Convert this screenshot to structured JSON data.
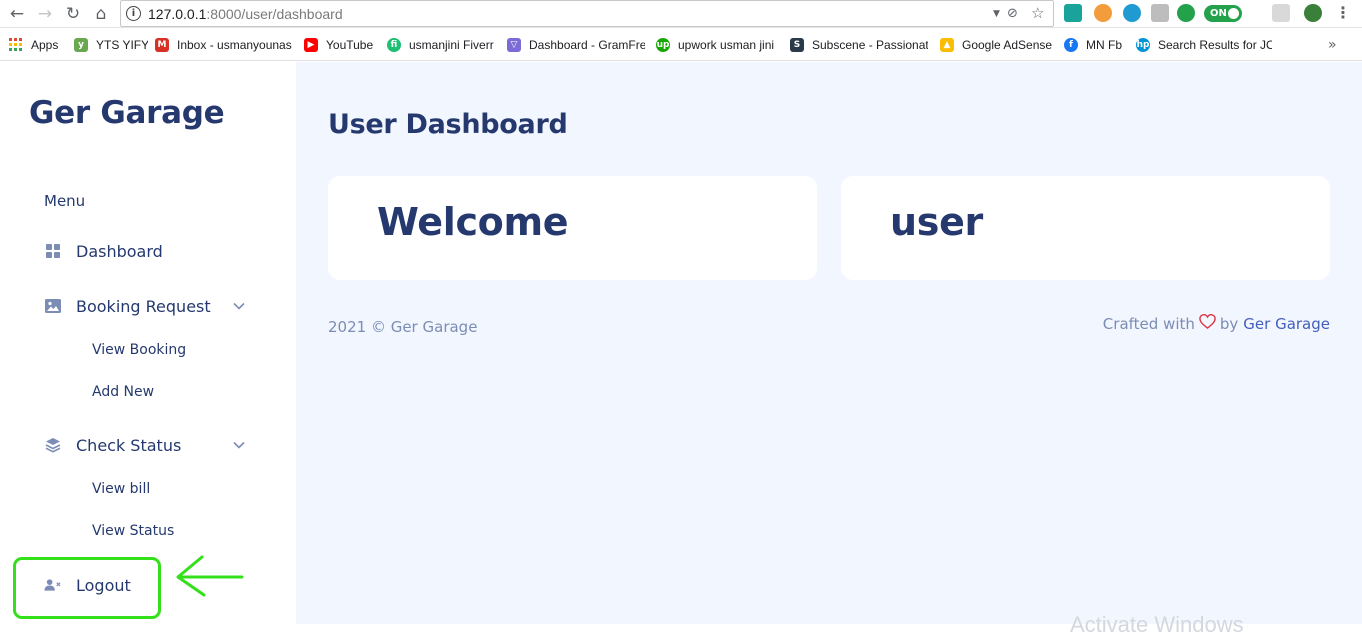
{
  "browser": {
    "url_host": "127.0.0.1",
    "url_rest": ":8000/user/dashboard",
    "toggle_label": "ON",
    "bookmarks": [
      {
        "label": "Apps",
        "icon": "apps-grid-icon",
        "color": "#e04a3b"
      },
      {
        "label": "YTS YIFY",
        "icon": "yts-icon",
        "color": "#6aa84f"
      },
      {
        "label": "Inbox - usmanyounas",
        "icon": "gmail-icon",
        "color": "#d93025"
      },
      {
        "label": "YouTube",
        "icon": "youtube-icon",
        "color": "#ff0000"
      },
      {
        "label": "usmanjini Fiverr",
        "icon": "fiverr-icon",
        "color": "#1dbf73"
      },
      {
        "label": "Dashboard - GramFre",
        "icon": "gramfree-icon",
        "color": "#7b6bd6"
      },
      {
        "label": "upwork usman jini",
        "icon": "upwork-icon",
        "color": "#14a800"
      },
      {
        "label": "Subscene - Passionat",
        "icon": "subscene-icon",
        "color": "#2b3a4a"
      },
      {
        "label": "Google AdSense",
        "icon": "adsense-icon",
        "color": "#fbbc04"
      },
      {
        "label": "MN Fb",
        "icon": "facebook-icon",
        "color": "#1877f2"
      },
      {
        "label": "Search Results for JOB",
        "icon": "hp-icon",
        "color": "#0096d6"
      }
    ]
  },
  "sidebar": {
    "brand": "Ger Garage",
    "menu_title": "Menu",
    "items": [
      {
        "label": "Dashboard",
        "icon": "grid-icon"
      },
      {
        "label": "Booking Request",
        "icon": "image-icon",
        "sub": [
          "View Booking",
          "Add New"
        ]
      },
      {
        "label": "Check Status",
        "icon": "layers-icon",
        "sub": [
          "View bill",
          "View Status"
        ]
      },
      {
        "label": "Logout",
        "icon": "user-x-icon"
      }
    ]
  },
  "main": {
    "title": "User Dashboard",
    "cards": [
      "Welcome",
      "user"
    ]
  },
  "footer": {
    "left": "2021 © Ger Garage",
    "crafted": "Crafted with",
    "by": "by",
    "link": "Ger Garage"
  },
  "colors": {
    "primary_text": "#25396f",
    "muted_text": "#7c8db5",
    "link": "#435ebe",
    "page_bg": "#f2f6fe",
    "annotation": "#34e01a",
    "heart": "#dc3545"
  },
  "watermark": "Activate Windows"
}
